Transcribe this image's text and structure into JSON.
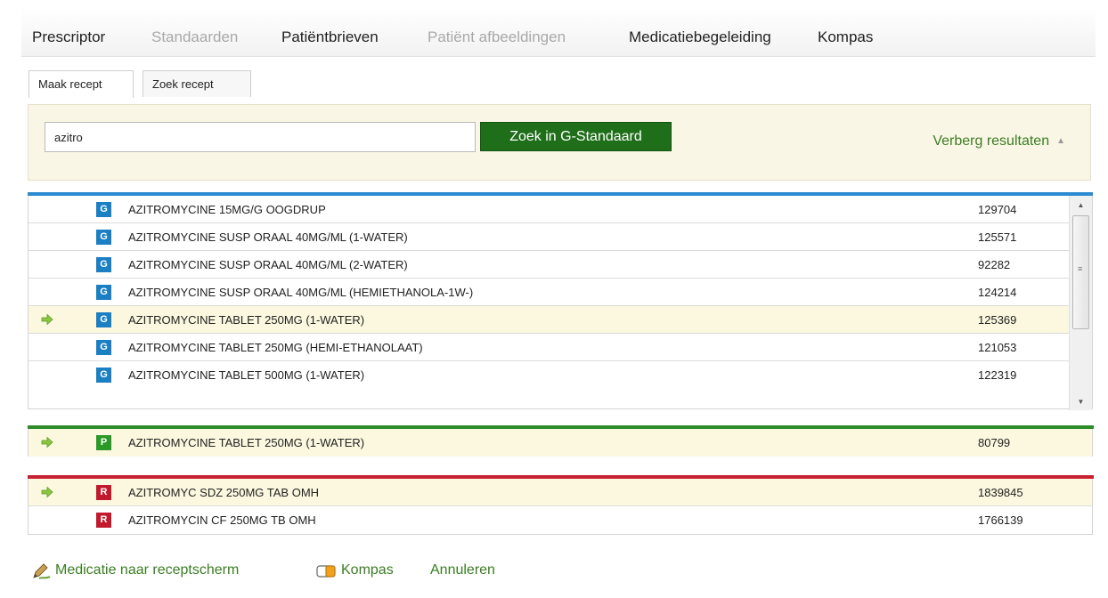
{
  "nav": {
    "items": [
      {
        "label": "Prescriptor",
        "disabled": false
      },
      {
        "label": "Standaarden",
        "disabled": true
      },
      {
        "label": "Patiëntbrieven",
        "disabled": false
      },
      {
        "label": "Patiënt afbeeldingen",
        "disabled": true
      },
      {
        "label": "Medicatiebegeleiding",
        "disabled": false
      },
      {
        "label": "Kompas",
        "disabled": false
      }
    ]
  },
  "tabs": [
    {
      "label": "Maak recept",
      "active": true
    },
    {
      "label": "Zoek recept",
      "active": false
    }
  ],
  "search": {
    "value": "azitro",
    "button_label": "Zoek in G-Standaard",
    "toggle_label": "Verberg resultaten"
  },
  "colors": {
    "g_section": "#2b8ad1",
    "p_section": "#2e8b2a",
    "r_section": "#c8202f",
    "button_green": "#1f6f1a",
    "link_green": "#3a7d22",
    "selected_row": "#fbf8df"
  },
  "results": {
    "g": [
      {
        "badge": "G",
        "name": "AZITROMYCINE 15MG/G OOGDRUP",
        "code": "129704",
        "selected": false
      },
      {
        "badge": "G",
        "name": "AZITROMYCINE SUSP ORAAL 40MG/ML (1-WATER)",
        "code": "125571",
        "selected": false
      },
      {
        "badge": "G",
        "name": "AZITROMYCINE SUSP ORAAL 40MG/ML (2-WATER)",
        "code": "92282",
        "selected": false
      },
      {
        "badge": "G",
        "name": "AZITROMYCINE SUSP ORAAL 40MG/ML (HEMIETHANOLA-1W-)",
        "code": "124214",
        "selected": false
      },
      {
        "badge": "G",
        "name": "AZITROMYCINE TABLET 250MG (1-WATER)",
        "code": "125369",
        "selected": true
      },
      {
        "badge": "G",
        "name": "AZITROMYCINE TABLET 250MG (HEMI-ETHANOLAAT)",
        "code": "121053",
        "selected": false
      },
      {
        "badge": "G",
        "name": "AZITROMYCINE TABLET 500MG (1-WATER)",
        "code": "122319",
        "selected": false
      }
    ],
    "p": [
      {
        "badge": "P",
        "name": "AZITROMYCINE TABLET 250MG (1-WATER)",
        "code": "80799",
        "selected": true
      }
    ],
    "r": [
      {
        "badge": "R",
        "name": "AZITROMYC SDZ 250MG TAB OMH",
        "code": "1839845",
        "selected": true
      },
      {
        "badge": "R",
        "name": "AZITROMYCIN CF 250MG TB OMH",
        "code": "1766139",
        "selected": false
      }
    ]
  },
  "footer": {
    "medication_label": "Medicatie naar receptscherm",
    "kompas_label": "Kompas",
    "cancel_label": "Annuleren"
  }
}
